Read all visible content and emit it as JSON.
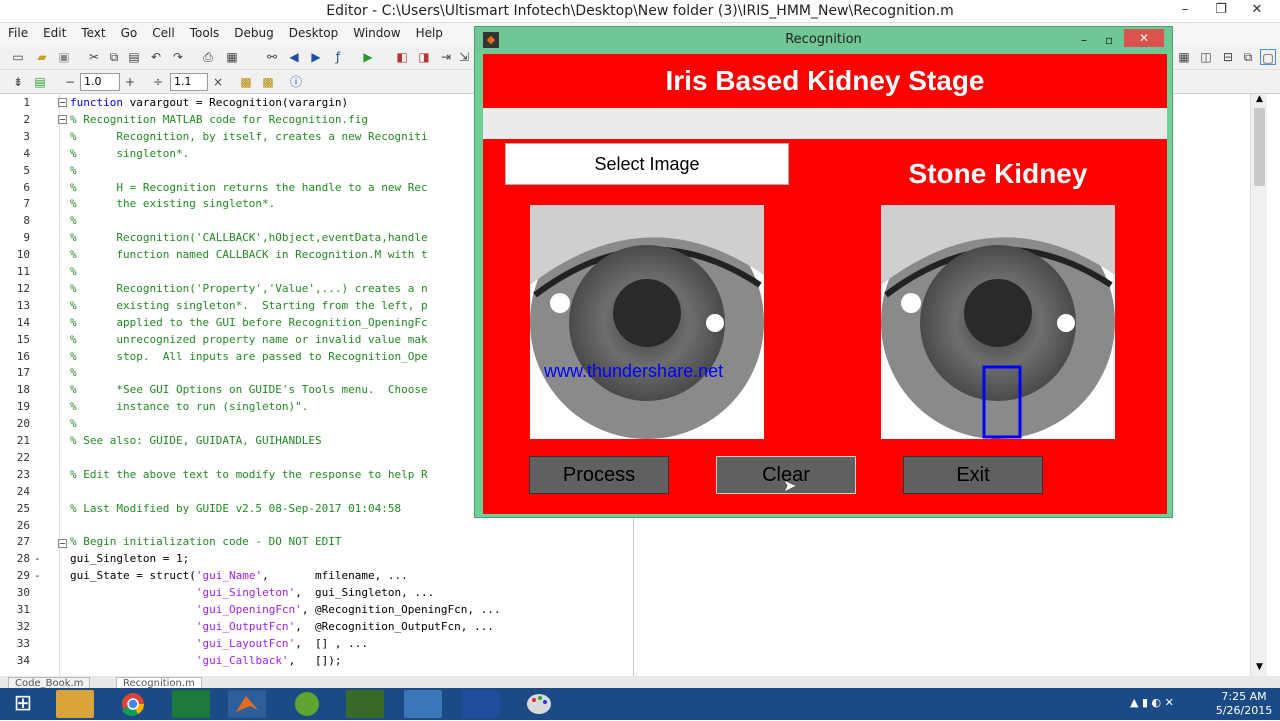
{
  "window": {
    "title": "Editor - C:\\Users\\Ultismart Infotech\\Desktop\\New folder (3)\\IRIS_HMM_New\\Recognition.m"
  },
  "menu": [
    "File",
    "Edit",
    "Text",
    "Go",
    "Cell",
    "Tools",
    "Debug",
    "Desktop",
    "Window",
    "Help"
  ],
  "toolbar2": {
    "minus_value": "1.0",
    "div_value": "1.1"
  },
  "editor": {
    "lines": [
      {
        "n": "1",
        "dash": "",
        "parts": [
          [
            "kw",
            "function "
          ],
          [
            "",
            "varargout = Recognition(varargin)"
          ]
        ]
      },
      {
        "n": "2",
        "dash": "",
        "parts": [
          [
            "cm",
            "% Recognition MATLAB code for Recognition.fig"
          ]
        ]
      },
      {
        "n": "3",
        "dash": "",
        "parts": [
          [
            "cm",
            "%      Recognition, by itself, creates a new Recogniti"
          ]
        ]
      },
      {
        "n": "4",
        "dash": "",
        "parts": [
          [
            "cm",
            "%      singleton*."
          ]
        ]
      },
      {
        "n": "5",
        "dash": "",
        "parts": [
          [
            "cm",
            "%"
          ]
        ]
      },
      {
        "n": "6",
        "dash": "",
        "parts": [
          [
            "cm",
            "%      H = Recognition returns the handle to a new Rec"
          ]
        ]
      },
      {
        "n": "7",
        "dash": "",
        "parts": [
          [
            "cm",
            "%      the existing singleton*."
          ]
        ]
      },
      {
        "n": "8",
        "dash": "",
        "parts": [
          [
            "cm",
            "%"
          ]
        ]
      },
      {
        "n": "9",
        "dash": "",
        "parts": [
          [
            "cm",
            "%      Recognition('CALLBACK',hObject,eventData,handle"
          ]
        ]
      },
      {
        "n": "10",
        "dash": "",
        "parts": [
          [
            "cm",
            "%      function named CALLBACK in Recognition.M with t"
          ]
        ]
      },
      {
        "n": "11",
        "dash": "",
        "parts": [
          [
            "cm",
            "%"
          ]
        ]
      },
      {
        "n": "12",
        "dash": "",
        "parts": [
          [
            "cm",
            "%      Recognition('Property','Value',...) creates a n"
          ]
        ]
      },
      {
        "n": "13",
        "dash": "",
        "parts": [
          [
            "cm",
            "%      existing singleton*.  Starting from the left, p"
          ]
        ]
      },
      {
        "n": "14",
        "dash": "",
        "parts": [
          [
            "cm",
            "%      applied to the GUI before Recognition_OpeningFc"
          ]
        ]
      },
      {
        "n": "15",
        "dash": "",
        "parts": [
          [
            "cm",
            "%      unrecognized property name or invalid value mak"
          ]
        ]
      },
      {
        "n": "16",
        "dash": "",
        "parts": [
          [
            "cm",
            "%      stop.  All inputs are passed to Recognition_Ope"
          ]
        ]
      },
      {
        "n": "17",
        "dash": "",
        "parts": [
          [
            "cm",
            "%"
          ]
        ]
      },
      {
        "n": "18",
        "dash": "",
        "parts": [
          [
            "cm",
            "%      *See GUI Options on GUIDE's Tools menu.  Choose"
          ]
        ]
      },
      {
        "n": "19",
        "dash": "",
        "parts": [
          [
            "cm",
            "%      instance to run (singleton)\"."
          ]
        ]
      },
      {
        "n": "20",
        "dash": "",
        "parts": [
          [
            "cm",
            "%"
          ]
        ]
      },
      {
        "n": "21",
        "dash": "",
        "parts": [
          [
            "cm",
            "% See also: GUIDE, GUIDATA, GUIHANDLES"
          ]
        ]
      },
      {
        "n": "22",
        "dash": "",
        "parts": []
      },
      {
        "n": "23",
        "dash": "",
        "parts": [
          [
            "cm",
            "% Edit the above text to modify the response to help R"
          ]
        ]
      },
      {
        "n": "24",
        "dash": "",
        "parts": []
      },
      {
        "n": "25",
        "dash": "",
        "parts": [
          [
            "cm",
            "% Last Modified by GUIDE v2.5 08-Sep-2017 01:04:58"
          ]
        ]
      },
      {
        "n": "26",
        "dash": "",
        "parts": []
      },
      {
        "n": "27",
        "dash": "",
        "parts": [
          [
            "cm",
            "% Begin initialization code - DO NOT EDIT"
          ]
        ]
      },
      {
        "n": "28",
        "dash": "-",
        "parts": [
          [
            "",
            "gui_Singleton = 1;"
          ]
        ]
      },
      {
        "n": "29",
        "dash": "-",
        "parts": [
          [
            "",
            "gui_State = struct("
          ],
          [
            "st",
            "'gui_Name'"
          ],
          [
            "",
            ",       mfilename, ..."
          ]
        ]
      },
      {
        "n": "30",
        "dash": "",
        "parts": [
          [
            "",
            "                   "
          ],
          [
            "st",
            "'gui_Singleton'"
          ],
          [
            "",
            ",  gui_Singleton, ..."
          ]
        ]
      },
      {
        "n": "31",
        "dash": "",
        "parts": [
          [
            "",
            "                   "
          ],
          [
            "st",
            "'gui_OpeningFcn'"
          ],
          [
            "",
            ", @Recognition_OpeningFcn, ..."
          ]
        ]
      },
      {
        "n": "32",
        "dash": "",
        "parts": [
          [
            "",
            "                   "
          ],
          [
            "st",
            "'gui_OutputFcn'"
          ],
          [
            "",
            ",  @Recognition_OutputFcn, ..."
          ]
        ]
      },
      {
        "n": "33",
        "dash": "",
        "parts": [
          [
            "",
            "                   "
          ],
          [
            "st",
            "'gui_LayoutFcn'"
          ],
          [
            "",
            ",  [] , ..."
          ]
        ]
      },
      {
        "n": "34",
        "dash": "",
        "parts": [
          [
            "",
            "                   "
          ],
          [
            "st",
            "'gui_Callback'"
          ],
          [
            "",
            ",   []);"
          ]
        ]
      }
    ]
  },
  "tabs": [
    "Code_Book.m",
    "Recognition.m"
  ],
  "figure": {
    "caption": "Recognition",
    "title": "Iris Based Kidney Stage",
    "select_label": "Select Image",
    "result_label": "Stone Kidney",
    "watermark": "www.thundershare.net",
    "buttons": {
      "process": "Process",
      "clear": "Clear",
      "exit": "Exit"
    }
  },
  "clock": {
    "time": "7:25 AM",
    "date": "5/26/2015"
  },
  "colors": {
    "figure_bg": "#ff0000",
    "figure_frame": "#6fcf97",
    "taskbar": "#1b4b86",
    "highlight_box": "#0000ff"
  }
}
